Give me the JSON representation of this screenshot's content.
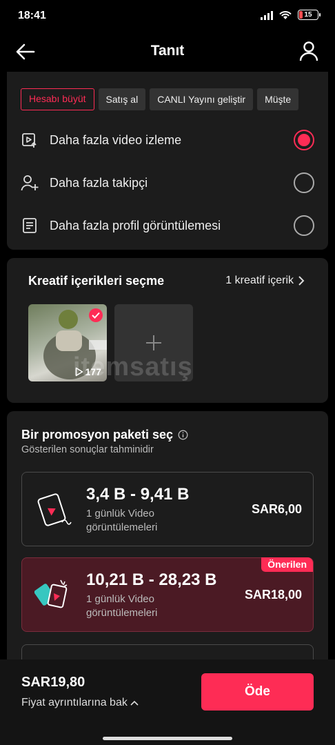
{
  "status_bar": {
    "time": "18:41",
    "battery": "15"
  },
  "header": {
    "title": "Tanıt"
  },
  "goals": {
    "chips": [
      {
        "label": "Hesabı büyüt",
        "active": true
      },
      {
        "label": "Satış al",
        "active": false
      },
      {
        "label": "CANLI Yayını geliştir",
        "active": false
      },
      {
        "label": "Müşte",
        "active": false
      }
    ],
    "options": [
      {
        "label": "Daha fazla video izleme",
        "icon": "video-play-icon",
        "selected": true
      },
      {
        "label": "Daha fazla takipçi",
        "icon": "add-user-icon",
        "selected": false
      },
      {
        "label": "Daha fazla profil görüntülemesi",
        "icon": "profile-doc-icon",
        "selected": false
      }
    ]
  },
  "creative": {
    "title": "Kreatif içerikleri seçme",
    "count_label": "1 kreatif içerik",
    "thumbnail_views": "177",
    "watermark": "itemsatış"
  },
  "packages": {
    "title": "Bir promosyon paketi seç",
    "subtitle": "Gösterilen sonuçlar tahminidir",
    "items": [
      {
        "range": "3,4 B - 9,41 B",
        "desc": "1 günlük Video görüntülemeleri",
        "price": "SAR6,00",
        "badge": ""
      },
      {
        "range": "10,21 B - 28,23 B",
        "desc": "1 günlük Video görüntülemeleri",
        "price": "SAR18,00",
        "badge": "Önerilen"
      }
    ]
  },
  "footer": {
    "total": "SAR19,80",
    "details_label": "Fiyat ayrıntılarına bak",
    "pay_label": "Öde"
  },
  "colors": {
    "accent": "#fe2c55",
    "card": "#1c1c1c",
    "recommended_bg": "#4b1a24"
  }
}
